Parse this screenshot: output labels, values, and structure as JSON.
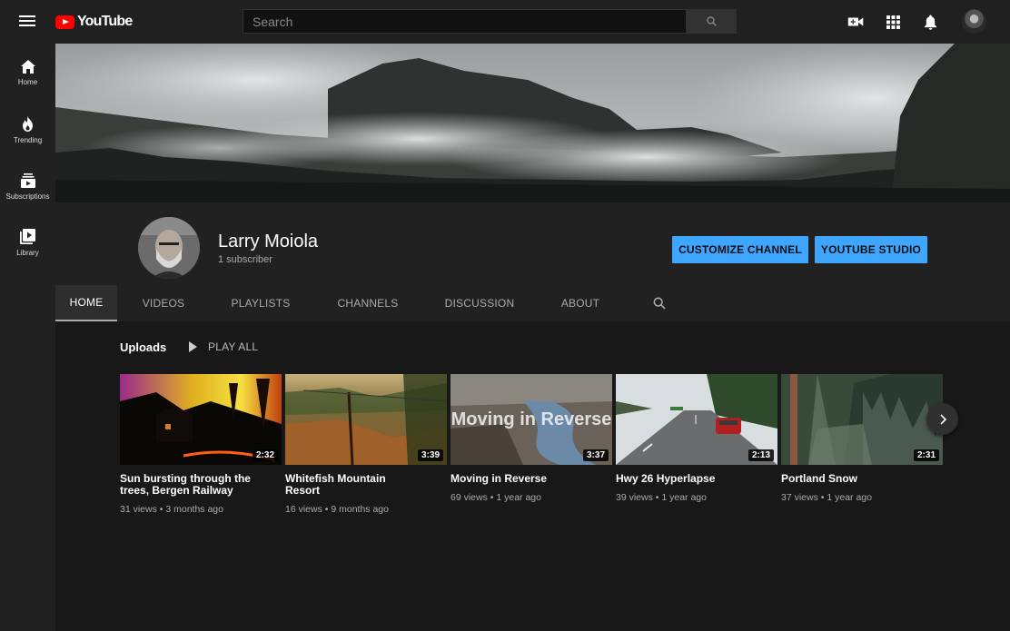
{
  "header": {
    "logo_text": "YouTube",
    "search_placeholder": "Search"
  },
  "sidebar": {
    "items": [
      {
        "label": "Home",
        "icon": "home-icon"
      },
      {
        "label": "Trending",
        "icon": "flame-icon"
      },
      {
        "label": "Subscriptions",
        "icon": "subscriptions-icon"
      },
      {
        "label": "Library",
        "icon": "library-icon"
      }
    ]
  },
  "channel": {
    "name": "Larry Moiola",
    "subscribers": "1 subscriber",
    "customize_label": "CUSTOMIZE CHANNEL",
    "studio_label": "YOUTUBE STUDIO"
  },
  "tabs": [
    {
      "label": "HOME",
      "active": true
    },
    {
      "label": "VIDEOS"
    },
    {
      "label": "PLAYLISTS"
    },
    {
      "label": "CHANNELS"
    },
    {
      "label": "DISCUSSION"
    },
    {
      "label": "ABOUT"
    }
  ],
  "uploads": {
    "title": "Uploads",
    "play_all": "PLAY ALL",
    "videos": [
      {
        "title": "Sun bursting through the trees, Bergen Railway",
        "meta": "31 views • 3 months ago",
        "duration": "2:32"
      },
      {
        "title": "Whitefish Mountain Resort",
        "meta": "16 views • 9 months ago",
        "duration": "3:39"
      },
      {
        "title": "Moving in Reverse",
        "meta": "69 views • 1 year ago",
        "duration": "3:37",
        "overlay_text": "Moving in Reverse"
      },
      {
        "title": "Hwy 26 Hyperlapse",
        "meta": "39 views • 1 year ago",
        "duration": "2:13"
      },
      {
        "title": "Portland Snow",
        "meta": "37 views • 1 year ago",
        "duration": "2:31"
      }
    ]
  },
  "colors": {
    "accent_blue": "#3ea6ff",
    "brand_red": "#ff0000",
    "background": "#181818",
    "surface": "#212121"
  }
}
